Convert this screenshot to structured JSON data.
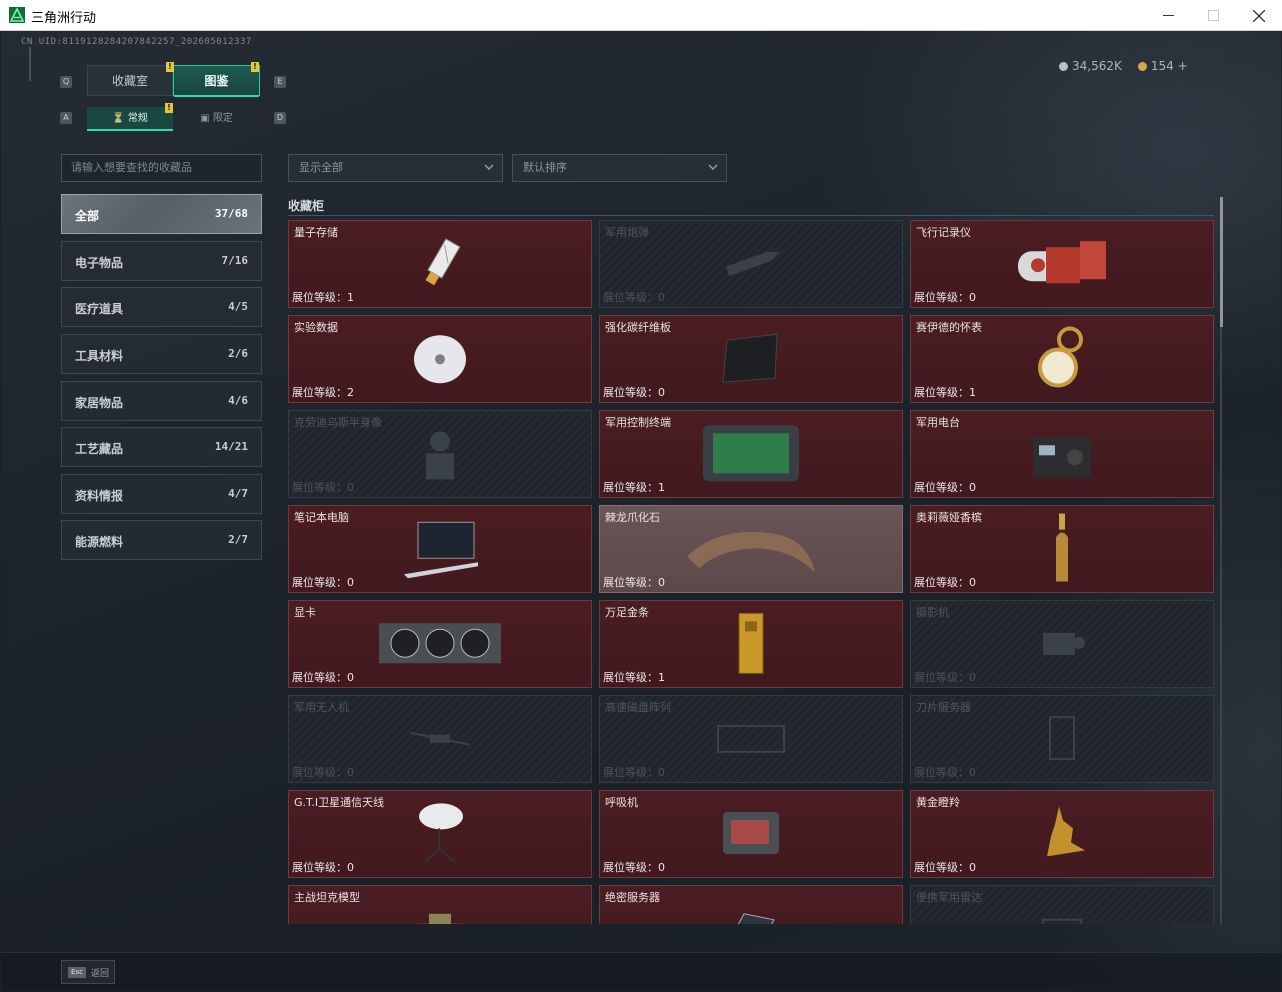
{
  "window": {
    "title": "三角洲行动",
    "minimize_icon": "minimize-icon",
    "maximize_icon": "maximize-icon",
    "close_icon": "close-icon"
  },
  "uid": "CN UID:8119128284207842257_202605012337",
  "currency": {
    "silver": "34,562K",
    "gold": "154 +"
  },
  "top_tabs": {
    "left_key": "Q",
    "right_key": "E",
    "items": [
      {
        "label": "收藏室"
      },
      {
        "label": "图鉴",
        "badge": "!"
      }
    ]
  },
  "sub_tabs": {
    "left_key": "A",
    "right_key": "D",
    "items": [
      {
        "label": "常规",
        "icon": "hourglass-icon",
        "badge": "!"
      },
      {
        "label": "限定",
        "icon": "box-icon"
      }
    ]
  },
  "search": {
    "placeholder": "请输入想要查找的收藏品"
  },
  "filters": {
    "show": "显示全部",
    "sort": "默认排序"
  },
  "categories": [
    {
      "name": "全部",
      "count": "37/68"
    },
    {
      "name": "电子物品",
      "count": "7/16"
    },
    {
      "name": "医疗道具",
      "count": "4/5"
    },
    {
      "name": "工具材料",
      "count": "2/6"
    },
    {
      "name": "家居物品",
      "count": "4/6"
    },
    {
      "name": "工艺藏品",
      "count": "14/21"
    },
    {
      "name": "资料情报",
      "count": "4/7"
    },
    {
      "name": "能源燃料",
      "count": "2/7"
    }
  ],
  "section_title": "收藏柜",
  "level_prefix": "展位等级：",
  "items": [
    {
      "name": "量子存储",
      "level": "1",
      "state": "owned",
      "icon": "usb-drive-icon"
    },
    {
      "name": "军用炮弹",
      "level": "0",
      "state": "locked",
      "icon": "artillery-shell-icon"
    },
    {
      "name": "飞行记录仪",
      "level": "0",
      "state": "owned",
      "icon": "flight-recorder-icon"
    },
    {
      "name": "实验数据",
      "level": "2",
      "state": "owned",
      "icon": "disc-icon"
    },
    {
      "name": "强化碳纤维板",
      "level": "0",
      "state": "owned",
      "icon": "carbon-plate-icon"
    },
    {
      "name": "赛伊德的怀表",
      "level": "1",
      "state": "owned",
      "icon": "pocket-watch-icon"
    },
    {
      "name": "克劳迪乌斯半身像",
      "level": "0",
      "state": "locked",
      "icon": "bust-icon"
    },
    {
      "name": "军用控制终端",
      "level": "1",
      "state": "owned",
      "icon": "terminal-icon"
    },
    {
      "name": "军用电台",
      "level": "0",
      "state": "owned",
      "icon": "radio-icon"
    },
    {
      "name": "笔记本电脑",
      "level": "0",
      "state": "owned",
      "icon": "laptop-icon"
    },
    {
      "name": "棘龙爪化石",
      "level": "0",
      "state": "highlight",
      "icon": "claw-fossil-icon"
    },
    {
      "name": "奥莉薇娅香槟",
      "level": "0",
      "state": "owned",
      "icon": "champagne-icon"
    },
    {
      "name": "显卡",
      "level": "0",
      "state": "owned",
      "icon": "graphics-card-icon"
    },
    {
      "name": "万足金条",
      "level": "1",
      "state": "owned",
      "icon": "gold-bar-icon"
    },
    {
      "name": "摄影机",
      "level": "0",
      "state": "locked",
      "icon": "camera-icon"
    },
    {
      "name": "军用无人机",
      "level": "0",
      "state": "locked",
      "icon": "drone-icon"
    },
    {
      "name": "高速磁盘阵列",
      "level": "0",
      "state": "locked",
      "icon": "disk-array-icon"
    },
    {
      "name": "刀片服务器",
      "level": "0",
      "state": "locked",
      "icon": "blade-server-icon"
    },
    {
      "name": "G.T.I卫星通信天线",
      "level": "0",
      "state": "owned",
      "icon": "satellite-dish-icon"
    },
    {
      "name": "呼吸机",
      "level": "0",
      "state": "owned",
      "icon": "ventilator-icon"
    },
    {
      "name": "黄金瞪羚",
      "level": "0",
      "state": "owned",
      "icon": "gold-gazelle-icon"
    },
    {
      "name": "主战坦克模型",
      "level": "",
      "state": "owned",
      "icon": "tank-model-icon"
    },
    {
      "name": "绝密服务器",
      "level": "",
      "state": "owned",
      "icon": "secret-server-icon"
    },
    {
      "name": "便携军用雷达",
      "level": "",
      "state": "locked",
      "icon": "radar-icon"
    }
  ],
  "bottom": {
    "esc_key": "Esc",
    "esc_label": "返回"
  },
  "colors": {
    "accent": "#22e4a8",
    "owned_bg": "#4a1d22",
    "locked_bg": "#242a30",
    "badge": "#e6c53a"
  }
}
